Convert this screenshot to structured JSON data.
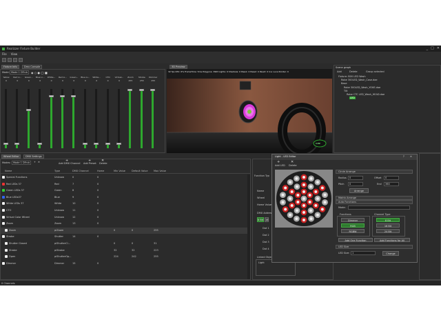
{
  "window": {
    "title": "Realizzer Fixture Builder",
    "minimize": "_",
    "maximize": "□",
    "close": "✕"
  },
  "menu": [
    "File",
    "View"
  ],
  "tabs": {
    "fixture_info": "Fixture Info",
    "dmx_console": "Dmx Console",
    "preview": "3D Preview",
    "scene_graph": "Scene graph",
    "wheel_editor": "Wheel Editor",
    "dmx_settings": "DMX Settings"
  },
  "console": {
    "mode_label": "Mode:",
    "mode_value": "Mode 1 DFrcb",
    "channels": [
      {
        "name": "Yellow",
        "value": "0",
        "level": 0.08
      },
      {
        "name": "Red Li...",
        "value": "0",
        "level": 0.08
      },
      {
        "name": "Green...",
        "value": "0",
        "level": 0.65
      },
      {
        "name": "Blue Li...",
        "value": "0",
        "level": 0.08
      },
      {
        "name": "White...",
        "value": "0",
        "level": 0.88
      },
      {
        "name": "Red Li...",
        "value": "0",
        "level": 0.88
      },
      {
        "name": "Green...",
        "value": "0",
        "level": 0.88
      },
      {
        "name": "Blue Li...",
        "value": "0",
        "level": 0.08
      },
      {
        "name": "White...",
        "value": "0",
        "level": 0.08
      },
      {
        "name": "CTO",
        "value": "0",
        "level": 0.08
      },
      {
        "name": "Virtual...",
        "value": "0",
        "level": 0.08
      },
      {
        "name": "Zoom",
        "value": "255",
        "level": 0.98
      },
      {
        "name": "Strobe",
        "value": "255",
        "level": 0.98
      },
      {
        "name": "Dimmer",
        "value": "255",
        "level": 0.98
      }
    ]
  },
  "preview": {
    "stats": "32 fps  CPU: 6%  FrameTime: 5ms  Polygons: 3963  Lights: 0  Shadows: 0  Pass1: 0  Pass2: 0  Pass3: 0  Ice: Luce Pointer: 0"
  },
  "scene_graph": {
    "add": "Add",
    "delete": "Delete",
    "group_selected": "Group selected",
    "nodes": [
      "Fixture: B00 LED Wash",
      "Robe 300LED_Wash_Case.dae",
      "Base",
      "Robe 300LED_Wash_YOKE.dae",
      "Tilt",
      "Robe CTC LED_Wash_HEAD.dae",
      "LED"
    ]
  },
  "wheel_editor": {
    "modes_label": "Modes:",
    "mode_value": "Mode 1 DFrcb",
    "add_dmx_channel": "Add DMX Channel",
    "add_preset": "Add Preset",
    "delete": "Delete",
    "columns": [
      "Name",
      "Type",
      "DMX Channel",
      "Home",
      "Min Value",
      "Default Value",
      "Max Value"
    ],
    "rows": [
      {
        "name": "Special Functions",
        "type": "Unknow",
        "ch": "0",
        "home": "0",
        "min": "",
        "def": "",
        "max": "",
        "indent": 0
      },
      {
        "name": "Red LEDs 37",
        "type": "Red",
        "ch": "7",
        "home": "0",
        "min": "",
        "def": "",
        "max": "",
        "indent": 0
      },
      {
        "name": "Green LEDs 37",
        "type": "Green",
        "ch": "8",
        "home": "0",
        "min": "",
        "def": "",
        "max": "",
        "indent": 0
      },
      {
        "name": "Blue LEDs37",
        "type": "Blue",
        "ch": "9",
        "home": "0",
        "min": "",
        "def": "",
        "max": "",
        "indent": 0
      },
      {
        "name": "White LEDs 37",
        "type": "White",
        "ch": "10",
        "home": "0",
        "min": "",
        "def": "",
        "max": "",
        "indent": 0
      },
      {
        "name": "CTO",
        "type": "Unknow",
        "ch": "11",
        "home": "0",
        "min": "",
        "def": "",
        "max": "",
        "indent": 0
      },
      {
        "name": "Virtual Color Wheel",
        "type": "Unknow",
        "ch": "12",
        "home": "0",
        "min": "",
        "def": "",
        "max": "",
        "indent": 0
      },
      {
        "name": "Zoom",
        "type": "Zoom",
        "ch": "13",
        "home": "0",
        "min": "",
        "def": "",
        "max": "",
        "indent": 0
      },
      {
        "name": "Zoom",
        "type": "piZoom",
        "ch": "",
        "home": "",
        "min": "0",
        "def": "0",
        "max": "255",
        "indent": 1
      },
      {
        "name": "Strobe",
        "type": "Shutter",
        "ch": "14",
        "home": "0",
        "min": "",
        "def": "",
        "max": "",
        "indent": 0
      },
      {
        "name": "Shutter Closed",
        "type": "piShutterCl...",
        "ch": "",
        "home": "",
        "min": "0",
        "def": "0",
        "max": "31",
        "indent": 1
      },
      {
        "name": "Strobe",
        "type": "piStrobe",
        "ch": "",
        "home": "",
        "min": "32",
        "def": "32",
        "max": "223",
        "indent": 1
      },
      {
        "name": "Open",
        "type": "piShutterOp...",
        "ch": "",
        "home": "",
        "min": "224",
        "def": "242",
        "max": "255",
        "indent": 1
      },
      {
        "name": "Dimmer",
        "type": "Dimmer",
        "ch": "15",
        "home": "0",
        "min": "",
        "def": "",
        "max": "",
        "indent": 0
      }
    ]
  },
  "function_panel": {
    "heading": "Function Typ",
    "name": "Name",
    "wheel": "Wheel",
    "home_value": "Home Value",
    "dmx_address": "DMX Addresse",
    "btn_8bit": "8 Bit",
    "btn_16bit": "16",
    "dot_labels": [
      "Dot 1",
      "Dot 2",
      "Dot 3",
      "Dot 4"
    ],
    "linked_objects": "Linked Object",
    "light": "Light"
  },
  "led_editor": {
    "title": "Light - LED Editor",
    "add_led": "Add LED",
    "delete": "Delete",
    "circle_arrange": "Circle Arrange",
    "radius_label": "Radius",
    "radius_value": "0",
    "offset_label": "Offset",
    "offset_value": "0",
    "pitch_label": "Pitch",
    "pitch_value": "0",
    "end_label": "End",
    "end_value": "360",
    "arrange": "Arrange",
    "matrix_arrange": "Matrix Arrange",
    "auto_functions": "Auto Functions",
    "mode_label": "Mode:",
    "functions_label": "Functions",
    "channel_type_label": "Channel Type",
    "fn_dimmer": "Dimmer",
    "fn_rgb": "RGB",
    "fn_rgbw": "RGBW",
    "ct_8bit": "8 Bit",
    "ct_16bit": "16 Bit",
    "ct_24bit": "24 Bit",
    "add_one_function": "Add One Function",
    "add_functions_for_all": "Add Functions for All",
    "led_size_header": "LED Size",
    "led_size_label": "LED Size:",
    "led_size_value": "1",
    "change": "Change"
  },
  "status": {
    "text": "0 Channels"
  }
}
